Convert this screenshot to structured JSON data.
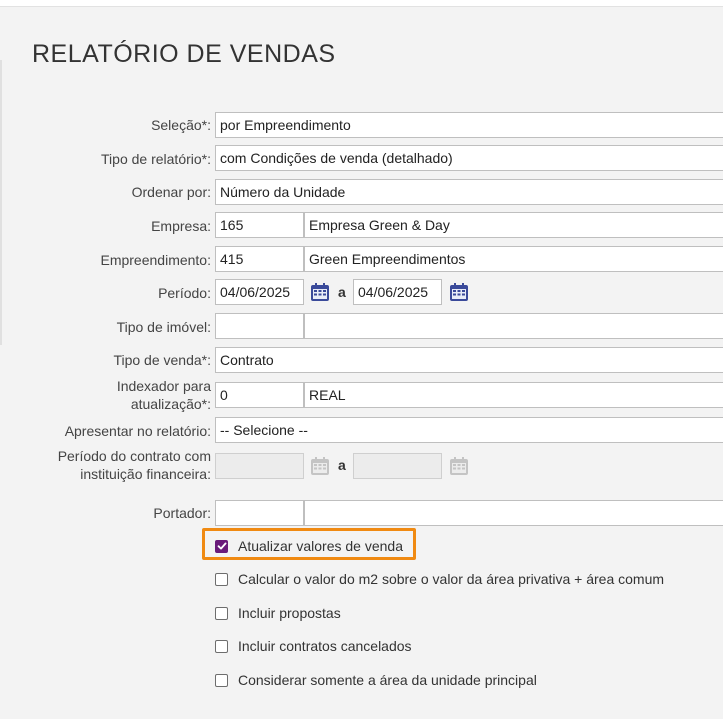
{
  "page": {
    "title": "RELATÓRIO DE VENDAS"
  },
  "form": {
    "selecao": {
      "label": "Seleção*:",
      "value": "por Empreendimento"
    },
    "tipo_relatorio": {
      "label": "Tipo de relatório*:",
      "value": "com Condições de venda (detalhado)"
    },
    "ordenar_por": {
      "label": "Ordenar por:",
      "value": "Número da Unidade"
    },
    "empresa": {
      "label": "Empresa:",
      "code": "165",
      "name": "Empresa Green & Day"
    },
    "empreendimento": {
      "label": "Empreendimento:",
      "code": "415",
      "name": "Green Empreendimentos"
    },
    "periodo": {
      "label": "Período:",
      "start": "04/06/2025",
      "separator": "a",
      "end": "04/06/2025"
    },
    "tipo_imovel": {
      "label": "Tipo de imóvel:",
      "code": "",
      "name": ""
    },
    "tipo_venda": {
      "label": "Tipo de venda*:",
      "value": "Contrato"
    },
    "indexador": {
      "label_line1": "Indexador para",
      "label_line2": "atualização*:",
      "code": "0",
      "name": "REAL"
    },
    "apresentar": {
      "label": "Apresentar no relatório:",
      "value": "-- Selecione --"
    },
    "periodo_contrato": {
      "label_line1": "Período do contrato com",
      "label_line2": "instituição financeira:",
      "start": "",
      "separator": "a",
      "end": ""
    },
    "portador": {
      "label": "Portador:",
      "code": "",
      "name": ""
    }
  },
  "options": [
    {
      "label": "Atualizar valores de venda",
      "checked": true
    },
    {
      "label": "Calcular o valor do m2 sobre o valor da área privativa + área comum",
      "checked": false
    },
    {
      "label": "Incluir propostas",
      "checked": false
    },
    {
      "label": "Incluir contratos cancelados",
      "checked": false
    },
    {
      "label": "Considerar somente a área da unidade principal",
      "checked": false
    }
  ],
  "colors": {
    "accent": "#6a1b7a",
    "highlight": "#f08a12",
    "calendar_icon": "#3a4a9a"
  }
}
